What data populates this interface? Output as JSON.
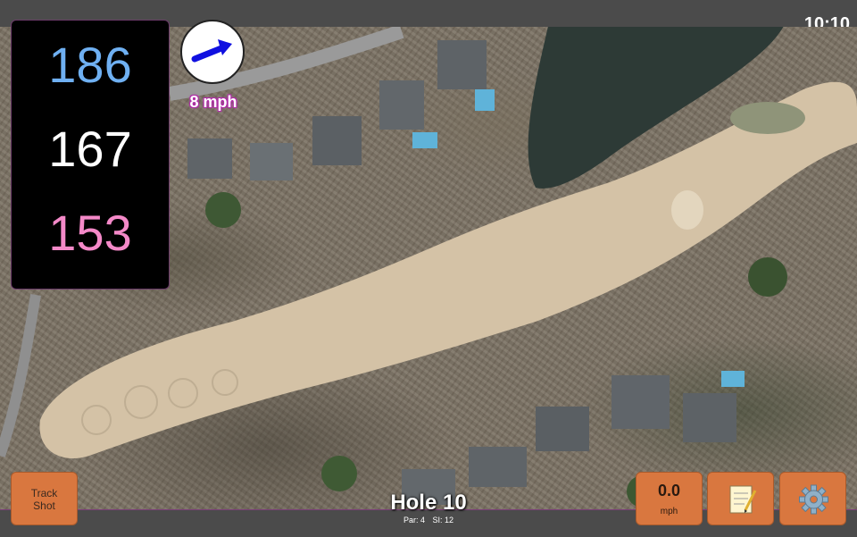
{
  "status": {
    "time": "10:10"
  },
  "distances": {
    "back": "186",
    "middle": "167",
    "front": "153"
  },
  "wind": {
    "speed_label": "8 mph",
    "direction_icon": "arrow-icon"
  },
  "hole": {
    "title": "Hole 10",
    "par": "Par: 4",
    "stroke_index": "SI: 12"
  },
  "buttons": {
    "track_shot": "Track\nShot",
    "speed_value": "0.0",
    "speed_unit": "mph",
    "notes_icon": "notepad-icon",
    "settings_icon": "gear-icon"
  },
  "colors": {
    "back_distance": "#6fb0f2",
    "middle_distance": "#ffffff",
    "front_distance": "#f489c8",
    "button": "#d9773f",
    "panel_border": "#7a3f78"
  }
}
